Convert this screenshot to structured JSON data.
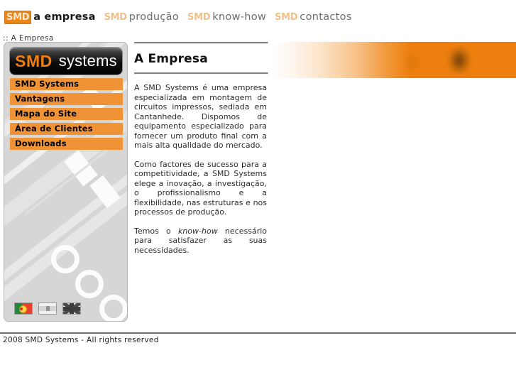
{
  "topnav": {
    "items": [
      {
        "prefix": "SMD",
        "label": "a empresa",
        "active": true
      },
      {
        "prefix": "SMD",
        "label": "produção",
        "active": false
      },
      {
        "prefix": "SMD",
        "label": "know-how",
        "active": false
      },
      {
        "prefix": "SMD",
        "label": "contactos",
        "active": false
      }
    ]
  },
  "breadcrumb": {
    "text": ":: A Empresa"
  },
  "sidebar": {
    "logo": {
      "smd": "SMD",
      "systems": "systems"
    },
    "items": [
      {
        "label": "SMD Systems"
      },
      {
        "label": "Vantagens"
      },
      {
        "label": "Mapa do Site"
      },
      {
        "label": "Área de Clientes"
      },
      {
        "label": "Downloads"
      }
    ],
    "flags": [
      {
        "name": "portuguese-flag",
        "title": "Português",
        "active": true
      },
      {
        "name": "spanish-flag",
        "title": "Español",
        "active": false
      },
      {
        "name": "english-flag",
        "title": "English",
        "active": false
      }
    ]
  },
  "content": {
    "title": "A Empresa",
    "paragraphs": [
      "A SMD Systems é uma empresa especializada em montagem de circuitos impressos, sediada em Cantanhede. Dispomos de equipamento especializado para fornecer um produto final com a mais alta qualidade do mercado.",
      "Como factores de sucesso para a competitividade, a SMD Systems elege a inovação, a investigação, o profissionalismo e a flexibilidade, nas estruturas e nos processos de produção."
    ],
    "paragraph_knowhow": {
      "before": "Temos o ",
      "italic": "know-how",
      "after": " necessário para satisfazer as suas necessidades."
    }
  },
  "footer": {
    "text": "2008 SMD Systems - All rights reserved"
  },
  "colors": {
    "accent_orange": "#ee7f0e",
    "button_orange": "#f09236",
    "nav_inactive": "#f0c08a",
    "sidebar_bg": "#d6d6d6"
  }
}
